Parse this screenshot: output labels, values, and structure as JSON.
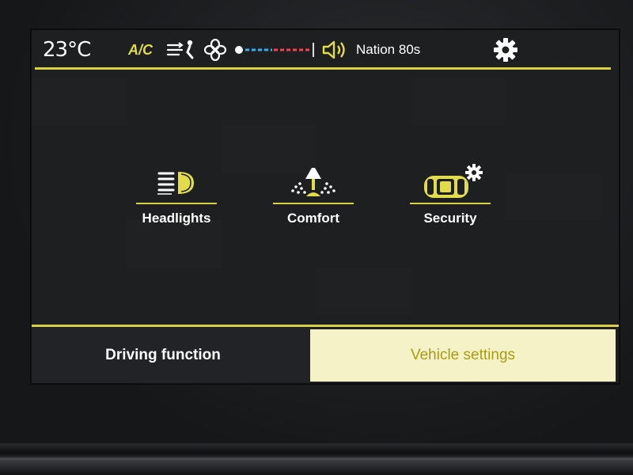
{
  "status_bar": {
    "temperature": "23°C",
    "ac_label": "A/C",
    "radio_station": "Nation 80s",
    "icons": [
      "airflow-icon",
      "fan-icon",
      "temperature-slider",
      "volume-icon",
      "settings-gear-icon"
    ]
  },
  "menu": {
    "items": [
      {
        "label": "Headlights",
        "icon": "headlight-icon"
      },
      {
        "label": "Comfort",
        "icon": "comfort-lamp-icon"
      },
      {
        "label": "Security",
        "icon": "security-car-icon"
      }
    ]
  },
  "tabs": [
    {
      "label": "Driving function",
      "active": false
    },
    {
      "label": "Vehicle settings",
      "active": true
    }
  ],
  "colors": {
    "accent": "#d8d146",
    "active_tab_bg": "#f5f2c8",
    "active_tab_text": "#a89c12",
    "slider_cold": "#3ab0e0",
    "slider_hot": "#e04a4a"
  }
}
